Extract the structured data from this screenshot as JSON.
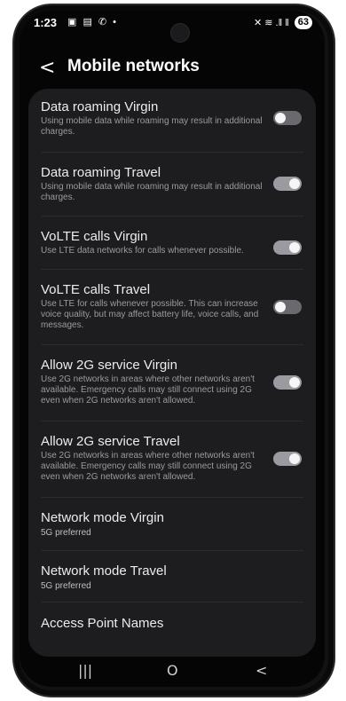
{
  "status_bar": {
    "time": "1:23",
    "left_icons": "▣ ▤ ✆ •",
    "battery": "63",
    "signal": "✕ ≋ .‖ ‖"
  },
  "header": {
    "back_glyph": "<",
    "title": "Mobile networks"
  },
  "settings": [
    {
      "title": "Data roaming Virgin",
      "description": "Using mobile data while roaming may result in additional charges.",
      "toggle": "off"
    },
    {
      "title": "Data roaming Travel",
      "description": "Using mobile data while roaming may result in additional charges.",
      "toggle": "on"
    },
    {
      "title": "VoLTE calls Virgin",
      "description": "Use LTE data networks for calls whenever possible.",
      "toggle": "on"
    },
    {
      "title": "VoLTE calls Travel",
      "description": "Use LTE for calls whenever possible. This can increase voice quality, but may affect battery life, voice calls, and messages.",
      "toggle": "off"
    },
    {
      "title": "Allow 2G service Virgin",
      "description": "Use 2G networks in areas where other networks aren't available. Emergency calls may still connect using 2G even when 2G networks aren't allowed.",
      "toggle": "on"
    },
    {
      "title": "Allow 2G service Travel",
      "description": "Use 2G networks in areas where other networks aren't available. Emergency calls may still connect using 2G even when 2G networks aren't allowed.",
      "toggle": "on"
    },
    {
      "title": "Network mode Virgin",
      "subtitle": "5G preferred"
    },
    {
      "title": "Network mode Travel",
      "subtitle": "5G preferred"
    },
    {
      "title": "Access Point Names"
    }
  ],
  "nav_bar": {
    "recents": "|||",
    "home": "O",
    "back": "<"
  }
}
